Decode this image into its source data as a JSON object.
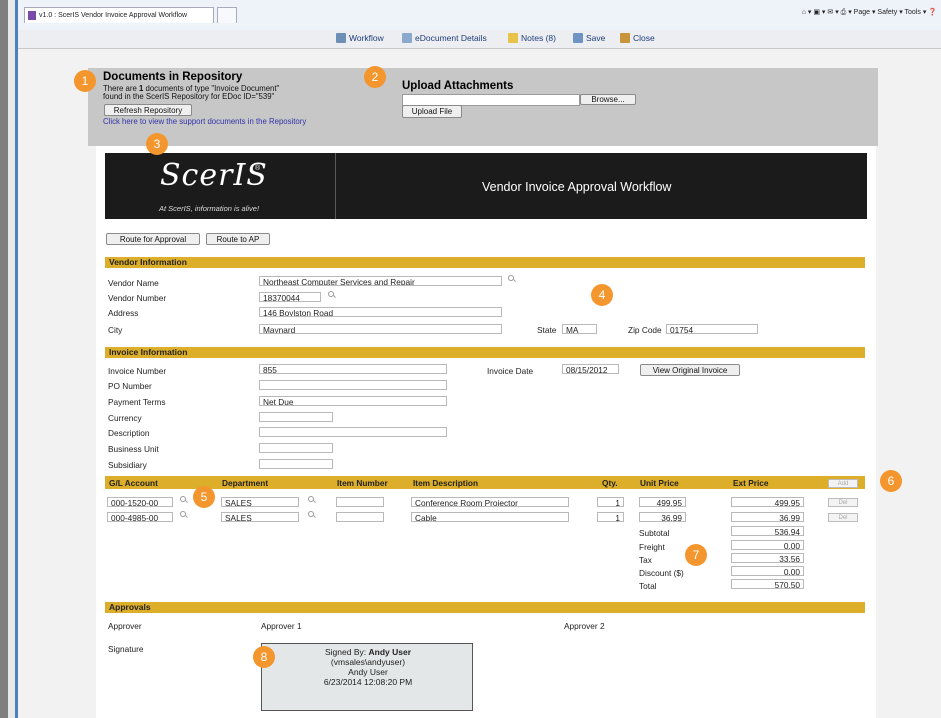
{
  "browser": {
    "tab_title": "v1.0 : ScerIS Vendor Invoice Approval Workflow",
    "tools": "⌂ ▾ ▣ ▾ ✉ ▾ ⎙ ▾ Page ▾ Safety ▾ Tools ▾ ❓"
  },
  "toolbar": {
    "workflow": "Workflow",
    "edoc_details": "eDocument Details",
    "notes": "Notes (8)",
    "save": "Save",
    "close": "Close"
  },
  "repository": {
    "title": "Documents in Repository",
    "text_1": "There are ",
    "count": "1",
    "text_2": " documents of type \"Invoice Document\"",
    "text_3": "found in the ScerIS Repository for EDoc ID=\"539\"",
    "refresh_label": "Refresh Repository",
    "link": "Click here to view the support documents in the Repository"
  },
  "upload": {
    "title": "Upload Attachments",
    "browse_label": "Browse...",
    "upload_label": "Upload File"
  },
  "banner": {
    "logo": "ScerIS",
    "reg": "®",
    "tagline": "At ScerIS, information is alive!",
    "title": "Vendor Invoice Approval Workflow"
  },
  "actions": {
    "route_approval": "Route for Approval",
    "route_ap": "Route to AP"
  },
  "vendor": {
    "section": "Vendor Information",
    "name_label": "Vendor Name",
    "name": "Northeast Computer Services and Repair",
    "number_label": "Vendor Number",
    "number": "18370044",
    "address_label": "Address",
    "address": "146 Boylston Road",
    "city_label": "City",
    "city": "Maynard",
    "state_label": "State",
    "state": "MA",
    "zip_label": "Zip Code",
    "zip": "01754"
  },
  "invoice": {
    "section": "Invoice Information",
    "number_label": "Invoice Number",
    "number": "855",
    "date_label": "Invoice Date",
    "date": "08/15/2012",
    "view_original": "View Original Invoice",
    "po_label": "PO Number",
    "po": "",
    "terms_label": "Payment Terms",
    "terms": "Net Due",
    "currency_label": "Currency",
    "currency": "",
    "description_label": "Description",
    "description": "",
    "bu_label": "Business Unit",
    "bu": "",
    "subsidiary_label": "Subsidiary",
    "subsidiary": ""
  },
  "lines": {
    "headers": {
      "gl": "G/L Account",
      "dept": "Department",
      "item": "Item Number",
      "desc": "Item Description",
      "qty": "Qty.",
      "unit": "Unit Price",
      "ext": "Ext Price",
      "add": "Add"
    },
    "rows": [
      {
        "gl": "000-1520-00",
        "dept": "SALES",
        "item": "",
        "desc": "Conference Room Projector",
        "qty": "1",
        "unit": "499.95",
        "ext": "499.95",
        "del": "Del"
      },
      {
        "gl": "000-4985-00",
        "dept": "SALES",
        "item": "",
        "desc": "Cable",
        "qty": "1",
        "unit": "36.99",
        "ext": "36.99",
        "del": "Del"
      }
    ],
    "subtotal_label": "Subtotal",
    "subtotal": "536.94",
    "freight_label": "Freight",
    "freight": "0.00",
    "tax_label": "Tax",
    "tax": "33.56",
    "discount_label": "Discount ($)",
    "discount": "0.00",
    "total_label": "Total",
    "total": "570.50"
  },
  "approvals": {
    "section": "Approvals",
    "approver_label": "Approver",
    "approver1": "Approver 1",
    "approver2": "Approver 2",
    "signature_label": "Signature",
    "signed_by_label": "Signed By: ",
    "signed_by": "Andy User",
    "account": "(vmsales\\andyuser)",
    "name": "Andy User",
    "timestamp": "6/23/2014 12:08:20 PM"
  },
  "callouts": [
    "1",
    "2",
    "3",
    "4",
    "5",
    "6",
    "7",
    "8"
  ],
  "colors": {
    "accent": "#dcae2a",
    "callout": "#f4962e",
    "banner": "#1b1b1b",
    "link": "#3333aa"
  }
}
